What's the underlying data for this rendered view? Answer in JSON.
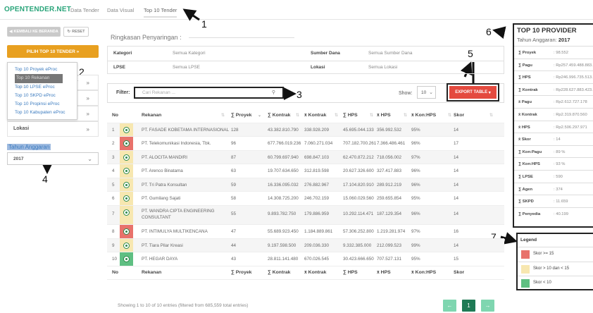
{
  "navbar": {
    "brand": "OPENTENDER.NET",
    "links": [
      "Data Tender",
      "Data Visual",
      "Top 10 Tender"
    ]
  },
  "annotations": [
    "1",
    "2",
    "3",
    "4",
    "5",
    "6",
    "7"
  ],
  "sidebar": {
    "back_label": "KEMBALI KE BERANDA",
    "reset_label": "RESET",
    "top10_label": "PILIH TOP 10 TENDER »",
    "dropdown": [
      "Top 10 Proyek eProc",
      "Top 10 Rekanan eProc",
      "Top 10 LPSE eProc",
      "Top 10 SKPD eProc",
      "Top 10 Propinsi eProc",
      "Top 10 Kabupaten eProc"
    ],
    "rows": [
      {
        "label": "",
        "chev": "»"
      },
      {
        "label": "",
        "chev": "»"
      },
      {
        "label": "",
        "chev": "»"
      },
      {
        "label": "Lokasi",
        "chev": "»"
      }
    ],
    "tahun_label": "Tahun Anggaran",
    "tahun_value": "2017"
  },
  "summary": {
    "title": "Ringkasan Penyaringan :",
    "kategori_key": "Kategori",
    "kategori_val": "Semua Kategori",
    "sumber_key": "Sumber Dana",
    "sumber_val": "Semua Sumber Dana",
    "lpse_key": "LPSE",
    "lpse_val": "Semua LPSE",
    "lokasi_key": "Lokasi",
    "lokasi_val": "Semua Lokasi"
  },
  "filter": {
    "label": "Filter:",
    "placeholder": "Cari Rekanan ...",
    "show_label": "Show:",
    "show_value": "10",
    "export_label": "EXPORT TABLE"
  },
  "table": {
    "headers": [
      "No",
      "Rekanan",
      "∑ Proyek",
      "∑ Kontrak",
      "x̄ Kontrak",
      "∑ HPS",
      "x̄ HPS",
      "x̄ Kon:HPS",
      "Skor"
    ],
    "footer_headers": [
      "No",
      "Rekanan",
      "∑ Proyek",
      "∑ Kontrak",
      "x̄ Kontrak",
      "∑ HPS",
      "x̄ HPS",
      "x̄ Kon:HPS",
      "Skor"
    ],
    "rows": [
      {
        "no": "1",
        "status": "#f7e7b0",
        "name": "PT. FASADE KOBETAMA INTERNASIONAL",
        "proyek": "128",
        "kontrak": "43.382.810.790",
        "avg_kontrak": "338.928.209",
        "hps": "45.695.044.133",
        "avg_hps": "356.992.532",
        "konhps": "95%",
        "skor": "14"
      },
      {
        "no": "2",
        "status": "#e8726b",
        "name": "PT. Telekomunikasi Indonesia, Tbk.",
        "proyek": "96",
        "kontrak": "677.766.019.236",
        "avg_kontrak": "7.060.271.034",
        "hps": "707.182.700.261",
        "avg_hps": "7.366.486.461",
        "konhps": "96%",
        "skor": "17"
      },
      {
        "no": "3",
        "status": "#f7e7b0",
        "name": "PT. ALOCITA MANDIRI",
        "proyek": "87",
        "kontrak": "60.799.697.940",
        "avg_kontrak": "698.847.103",
        "hps": "62.470.872.212",
        "avg_hps": "718.056.002",
        "konhps": "97%",
        "skor": "14"
      },
      {
        "no": "4",
        "status": "#f7e7b0",
        "name": "PT. Arenco Binatama",
        "proyek": "63",
        "kontrak": "19.707.634.650",
        "avg_kontrak": "312.819.598",
        "hps": "20.627.326.600",
        "avg_hps": "327.417.883",
        "konhps": "96%",
        "skor": "14"
      },
      {
        "no": "5",
        "status": "#f7e7b0",
        "name": "PT. Tri Patra Konsultan",
        "proyek": "59",
        "kontrak": "16.336.095.032",
        "avg_kontrak": "276.882.967",
        "hps": "17.104.820.910",
        "avg_hps": "289.912.219",
        "konhps": "96%",
        "skor": "14"
      },
      {
        "no": "6",
        "status": "#f7e7b0",
        "name": "PT. Gumilang Sajati",
        "proyek": "58",
        "kontrak": "14.308.725.200",
        "avg_kontrak": "246.702.159",
        "hps": "15.060.029.560",
        "avg_hps": "259.655.854",
        "konhps": "95%",
        "skor": "14"
      },
      {
        "no": "7",
        "status": "#f7e7b0",
        "name": "PT. WANDRA CIPTA ENGINEERING CONSULTANT",
        "proyek": "55",
        "kontrak": "9.893.782.750",
        "avg_kontrak": "179.886.959",
        "hps": "10.292.114.471",
        "avg_hps": "187.129.354",
        "konhps": "96%",
        "skor": "14"
      },
      {
        "no": "8",
        "status": "#e8726b",
        "name": "PT. INTIMULYA MULTIKENCANA",
        "proyek": "47",
        "kontrak": "55.689.923.450",
        "avg_kontrak": "1.184.889.861",
        "hps": "57.306.252.800",
        "avg_hps": "1.219.281.974",
        "konhps": "97%",
        "skor": "16"
      },
      {
        "no": "9",
        "status": "#f7e7b0",
        "name": "PT. Tiara Pilar Kreasi",
        "proyek": "44",
        "kontrak": "9.197.598.500",
        "avg_kontrak": "209.036.330",
        "hps": "9.332.385.000",
        "avg_hps": "212.099.523",
        "konhps": "99%",
        "skor": "14"
      },
      {
        "no": "10",
        "status": "#5fbf82",
        "name": "PT. HEGAR DAYA",
        "proyek": "43",
        "kontrak": "28.811.141.480",
        "avg_kontrak": "670.026.545",
        "hps": "30.423.666.650",
        "avg_hps": "707.527.131",
        "konhps": "95%",
        "skor": "15"
      }
    ],
    "info": "Showing 1 to 10 of 10 entries (filtered from 685,559 total entries)",
    "page": "1"
  },
  "right_panel": {
    "title": "TOP 10 PROVIDER",
    "sub_label": "Tahun Anggaran:",
    "sub_value": "2017",
    "rows": [
      {
        "k": "∑ Proyek",
        "v": ": 98.552"
      },
      {
        "k": "∑ Pagu",
        "v": ": Rp257.459.488.883.6"
      },
      {
        "k": "∑ HPS",
        "v": ": Rp246.996.735.513.9"
      },
      {
        "k": "∑ Kontrak",
        "v": ": Rp228.627.883.423.5"
      },
      {
        "k": "x̄ Pagu",
        "v": ": Rp2.612.727.178"
      },
      {
        "k": "x̄ Kontrak",
        "v": ": Rp2.319.870.560"
      },
      {
        "k": "x̄ HPS",
        "v": ": Rp2.506.297.971"
      },
      {
        "k": "x̄ Skor",
        "v": ": 14"
      },
      {
        "k": "∑ Kon:Pagu",
        "v": ": 89 %"
      },
      {
        "k": "∑ Kon:HPS",
        "v": ": 93 %"
      },
      {
        "k": "∑ LPSE",
        "v": ": 590"
      },
      {
        "k": "∑ Agen",
        "v": ": 374"
      },
      {
        "k": "∑ SKPD",
        "v": ": 11.659"
      },
      {
        "k": "∑ Penyedia",
        "v": ": 40.199"
      }
    ]
  },
  "legend": {
    "title": "Legend",
    "items": [
      {
        "color": "#e8726b",
        "label": "Skor >= 15"
      },
      {
        "color": "#f7e7b0",
        "label": "Skor > 10 dan < 15"
      },
      {
        "color": "#5fbf82",
        "label": "Skor < 10"
      }
    ]
  },
  "colors": {
    "brand": "#2aa57a",
    "accent": "#e8a020",
    "export": "#e44a3f",
    "pager": "#2aa57a"
  }
}
